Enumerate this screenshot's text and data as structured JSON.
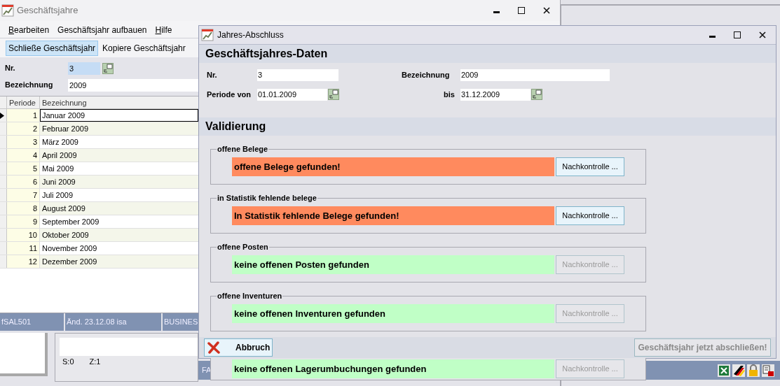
{
  "main_window": {
    "title": "Geschäftsjahre",
    "menu": [
      {
        "label": "Bearbeiten",
        "underline_first": true
      },
      {
        "label": "Geschäftsjahr aufbauen",
        "underline_first": false
      },
      {
        "label": "Hilfe",
        "underline_first": true
      }
    ],
    "toolbar": [
      {
        "label": "Schließe Geschäftsjahr",
        "selected": true
      },
      {
        "label": "Kopiere Geschäftsjahr",
        "selected": false
      }
    ],
    "fields": [
      {
        "label": "Nr.",
        "value": "3",
        "kind": "picker"
      },
      {
        "label": "Bezeichnung",
        "value": "2009",
        "kind": "text"
      }
    ],
    "table": {
      "columns": [
        "Periode",
        "Bezeichnung"
      ],
      "rows": [
        {
          "periode": "1",
          "bezeichnung": "Januar 2009",
          "selected": true
        },
        {
          "periode": "2",
          "bezeichnung": "Februar 2009",
          "selected": false
        },
        {
          "periode": "3",
          "bezeichnung": "März 2009",
          "selected": false
        },
        {
          "periode": "4",
          "bezeichnung": "April 2009",
          "selected": false
        },
        {
          "periode": "5",
          "bezeichnung": "Mai 2009",
          "selected": false
        },
        {
          "periode": "6",
          "bezeichnung": "Juni 2009",
          "selected": false
        },
        {
          "periode": "7",
          "bezeichnung": "Juli 2009",
          "selected": false
        },
        {
          "periode": "8",
          "bezeichnung": "August 2009",
          "selected": false
        },
        {
          "periode": "9",
          "bezeichnung": "September 2009",
          "selected": false
        },
        {
          "periode": "10",
          "bezeichnung": "Oktober 2009",
          "selected": false
        },
        {
          "periode": "11",
          "bezeichnung": "November 2009",
          "selected": false
        },
        {
          "periode": "12",
          "bezeichnung": "Dezember 2009",
          "selected": false
        }
      ]
    },
    "status_bar": [
      "fSAL501",
      "Änd. 23.12.08 isa",
      "BUSINES"
    ],
    "lower_panel": [
      "S:0",
      "Z:1"
    ],
    "bottom_status": "FA"
  },
  "dialog": {
    "title": "Jahres-Abschluss",
    "section_title": "Geschäftsjahres-Daten",
    "fields": [
      {
        "label": "Nr.",
        "value": "3",
        "kind": "text"
      },
      {
        "label": "Bezeichnung",
        "value": "2009",
        "kind": "text"
      },
      {
        "label": "Periode von",
        "value": "01.01.2009",
        "kind": "date"
      },
      {
        "label": "bis",
        "value": "31.12.2009",
        "kind": "date"
      }
    ],
    "validation_title": "Validierung",
    "checks": [
      {
        "title": "offene Belege",
        "message": "offene Belege gefunden!",
        "color": "#ff8a5e",
        "button": "Nachkontrolle ...",
        "disabled": false
      },
      {
        "title": "in Statistik fehlende belege",
        "message": "In Statistik fehlende Belege gefunden!",
        "color": "#ff8a5e",
        "button": "Nachkontrolle ...",
        "disabled": false
      },
      {
        "title": "offene Posten",
        "message": "keine offenen Posten gefunden",
        "color": "#c0ffc6",
        "button": "Nachkontrolle ...",
        "disabled": true
      },
      {
        "title": "offene Inventuren",
        "message": "keine offenen Inventuren gefunden",
        "color": "#c0ffc6",
        "button": "Nachkontrolle ...",
        "disabled": true
      },
      {
        "message": "keine offenen Lagerumbuchungen gefunden",
        "color": "#c0ffc6",
        "button": "Nachkontrolle ...",
        "disabled": true
      }
    ],
    "cancel_button": "Abbruch",
    "confirm_button": {
      "label": "Geschäftsjahr jetzt abschließen!",
      "disabled": true
    }
  }
}
